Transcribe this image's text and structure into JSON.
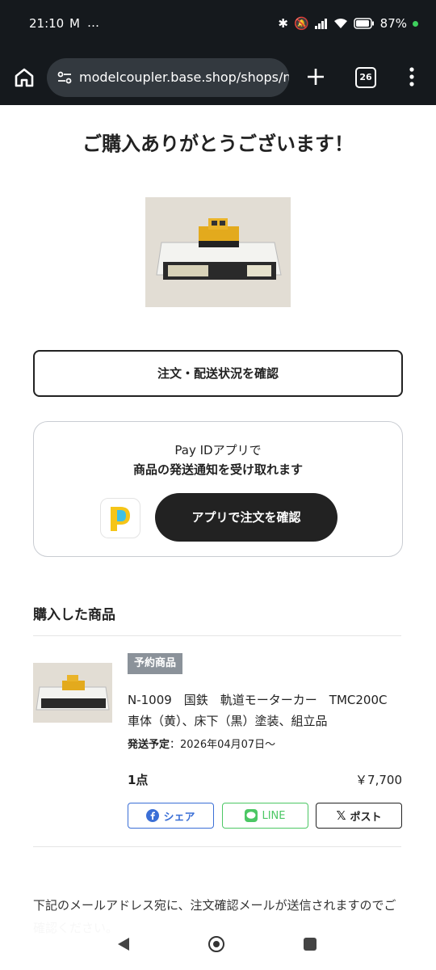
{
  "status_bar": {
    "time": "21:10",
    "mail_icon": "gmail-icon",
    "overflow": "…",
    "battery": "87%"
  },
  "browser": {
    "url": "modelcoupler.base.shop/shops/n",
    "tab_count": "26"
  },
  "page": {
    "title": "ご購入ありがとうございます！",
    "order_status_button": "注文・配送状況を確認",
    "payid": {
      "line1": "Pay IDアプリで",
      "line2": "商品の発送通知を受け取れます",
      "button": "アプリで注文を確認"
    },
    "purchased_section_title": "購入した商品",
    "item": {
      "badge": "予約商品",
      "name": "N-1009　国鉄　軌道モーターカー　TMC200C　車体（黄）、床下（黒）塗装、組立品",
      "ship_label": "発送予定",
      "ship_value": "：2026年04月07日〜",
      "quantity": "1点",
      "price": "￥7,700"
    },
    "share": {
      "facebook": "シェア",
      "line": "LINE",
      "x": "ポスト"
    },
    "notice": "下記のメールアドレス宛に、注文確認メールが送信されますのでご確認ください。"
  },
  "colors": {
    "accent_dark": "#222222",
    "facebook": "#3b6fd6",
    "line": "#4cc764",
    "badge": "#8b929a"
  }
}
